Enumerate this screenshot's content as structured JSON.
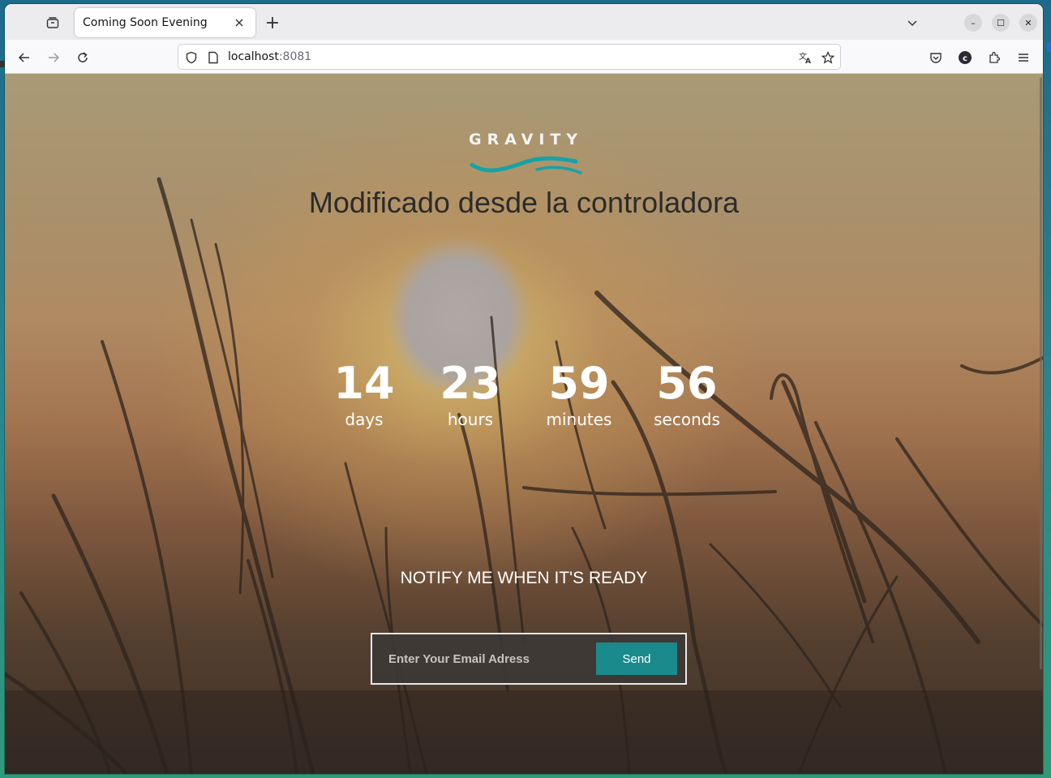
{
  "browser": {
    "tab_title": "Coming Soon Evening",
    "new_tab_symbol": "+",
    "url_host": "localhost",
    "url_port": ":8081",
    "window_buttons": {
      "minimize": "–",
      "maximize": "☐",
      "close": "✕"
    }
  },
  "page": {
    "logo": "GRAVITY",
    "headline": "Modificado desde la controladora",
    "countdown": [
      {
        "value": "14",
        "label": "days"
      },
      {
        "value": "23",
        "label": "hours"
      },
      {
        "value": "59",
        "label": "minutes"
      },
      {
        "value": "56",
        "label": "seconds"
      }
    ],
    "notify_title": "NOTIFY ME WHEN IT'S READY",
    "email_placeholder": "Enter Your Email Adress",
    "send_label": "Send"
  },
  "colors": {
    "accent_teal": "#1a8a8c",
    "logo_wave": "#17a2a6"
  }
}
